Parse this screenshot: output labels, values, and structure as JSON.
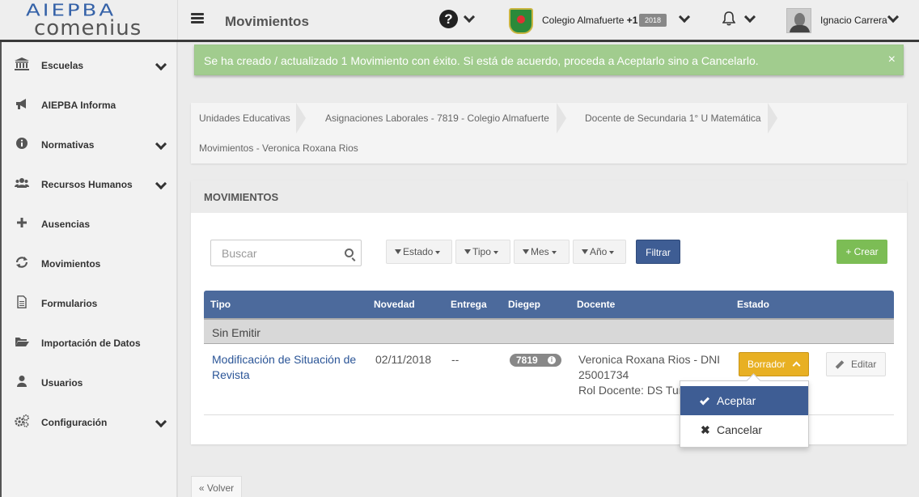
{
  "logo": {
    "line1": "AIEPBA",
    "line2": "comenius"
  },
  "header": {
    "title": "Movimientos",
    "school": "Colegio Almafuerte",
    "school_extra": "+1",
    "year": "2018",
    "user": "Ignacio Carrera"
  },
  "sidebar": {
    "items": [
      {
        "label": "Escuelas",
        "icon": "bank-icon"
      },
      {
        "label": "AIEPBA Informa",
        "icon": "megaphone-icon"
      },
      {
        "label": "Normativas",
        "icon": "info-icon"
      },
      {
        "label": "Recursos Humanos",
        "icon": "users-icon"
      },
      {
        "label": "Ausencias",
        "icon": "plus-icon"
      },
      {
        "label": "Movimientos",
        "icon": "refresh-icon"
      },
      {
        "label": "Formularios",
        "icon": "document-icon"
      },
      {
        "label": "Importación de Datos",
        "icon": "folder-open-icon"
      },
      {
        "label": "Usuarios",
        "icon": "user-icon"
      },
      {
        "label": "Configuración",
        "icon": "gears-icon"
      }
    ]
  },
  "alert": {
    "message": "Se ha creado / actualizado 1 Movimiento con éxito. Si está de acuerdo, proceda a Aceptarlo sino a Cancelarlo.",
    "close": "×"
  },
  "breadcrumb": {
    "c1": "Unidades Educativas",
    "c2": "Asignaciones Laborales - 7819 - Colegio Almafuerte",
    "c3": "Docente de Secundaria 1° U Matemática",
    "c4": "Movimientos - Veronica Roxana Rios"
  },
  "panel": {
    "title": "MOVIMIENTOS",
    "search_placeholder": "Buscar",
    "filters": {
      "estado": "Estado",
      "tipo": "Tipo",
      "mes": "Mes",
      "anio": "Año"
    },
    "filter_button": "Filtrar",
    "create_button": "+ Crear"
  },
  "table": {
    "columns": {
      "tipo": "Tipo",
      "novedad": "Novedad",
      "entrega": "Entrega",
      "diegep": "Diegep",
      "docente": "Docente",
      "estado": "Estado"
    },
    "group": "Sin Emitir",
    "row": {
      "tipo_line1": "Modificación de Situación de",
      "tipo_line2": "Revista",
      "novedad": "02/11/2018",
      "entrega": "--",
      "diegep": "7819",
      "docente_line1": "Veronica Roxana Rios - DNI",
      "docente_line2": "25001734",
      "docente_line3": "Rol Docente: DS Turn",
      "estado": "Borrador",
      "edit": "Editar"
    }
  },
  "dropdown": {
    "accept": "Aceptar",
    "cancel": "Cancelar"
  },
  "footer": {
    "back": "« Volver"
  },
  "colors": {
    "primary": "#3e5d94",
    "success": "#a1cc8e",
    "warning": "#e8b023",
    "create": "#7cbd55"
  }
}
